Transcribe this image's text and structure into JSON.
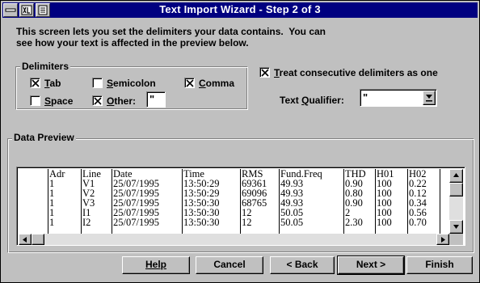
{
  "window": {
    "title": "Text Import Wizard - Step 2 of 3",
    "intro_line1": "This screen lets you set the delimiters your data contains.  You can",
    "intro_line2": "see how your text is affected in the preview below."
  },
  "delimiters": {
    "legend": "Delimiters",
    "tab": {
      "label": "Tab",
      "checked": true
    },
    "semicolon": {
      "label": "Semicolon",
      "checked": false
    },
    "comma": {
      "label": "Comma",
      "checked": true
    },
    "space": {
      "label": "Space",
      "checked": false
    },
    "other": {
      "label": "Other:",
      "checked": true,
      "value": "\""
    }
  },
  "consecutive": {
    "label": "Treat consecutive delimiters as one",
    "checked": true
  },
  "qualifier": {
    "label": "Text Qualifier:",
    "value": "\""
  },
  "preview": {
    "legend": "Data Preview",
    "columns": [
      "",
      "Adr",
      "Line",
      "Date",
      "Time",
      "RMS",
      "Fund.Freq",
      "THD",
      "H01",
      "H02"
    ],
    "rows": [
      [
        "",
        "1",
        "V1",
        "25/07/1995",
        "13:50:29",
        "69361",
        "49.93",
        "0.90",
        "100",
        "0.22"
      ],
      [
        "",
        "1",
        "V2",
        "25/07/1995",
        "13:50:29",
        "69096",
        "49.93",
        "0.80",
        "100",
        "0.12"
      ],
      [
        "",
        "1",
        "V3",
        "25/07/1995",
        "13:50:30",
        "68765",
        "49.93",
        "0.90",
        "100",
        "0.34"
      ],
      [
        "",
        "1",
        "I1",
        "25/07/1995",
        "13:50:30",
        "12",
        "50.05",
        "2",
        "100",
        "0.56"
      ],
      [
        "",
        "1",
        "I2",
        "25/07/1995",
        "13:50:30",
        "12",
        "50.05",
        "2.30",
        "100",
        "0.70"
      ]
    ]
  },
  "buttons": {
    "help": "Help",
    "cancel": "Cancel",
    "back": "< Back",
    "next": "Next >",
    "finish": "Finish"
  }
}
